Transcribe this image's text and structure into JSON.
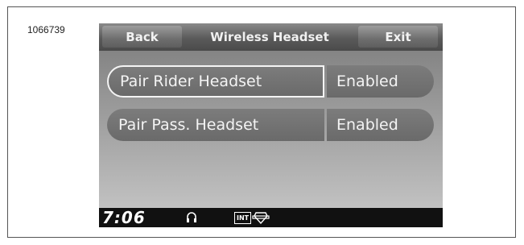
{
  "figure_id": "1066739",
  "header": {
    "back_label": "Back",
    "title": "Wireless Headset",
    "exit_label": "Exit"
  },
  "settings": [
    {
      "label": "Pair Rider Headset",
      "value": "Enabled",
      "selected": true
    },
    {
      "label": "Pair Pass. Headset",
      "value": "Enabled",
      "selected": false
    }
  ],
  "statusbar": {
    "time": "7:06",
    "int_badge": "INT",
    "icons": [
      "headset-icon",
      "int-icon",
      "bar-shield-icon"
    ]
  },
  "colors": {
    "screen_bg": "#9d9d9d",
    "button": "#6e6e6e",
    "status_bar": "#111111",
    "text": "#f4f4f4"
  }
}
